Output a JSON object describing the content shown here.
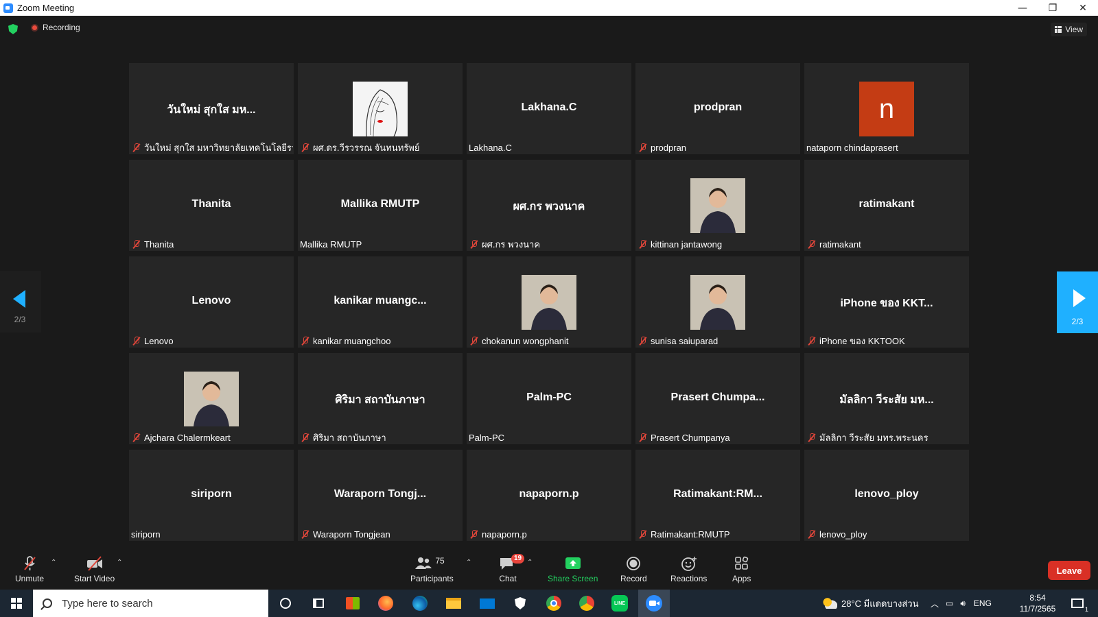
{
  "window": {
    "title": "Zoom Meeting",
    "minimize": "—",
    "restore": "❐",
    "close": "✕"
  },
  "header": {
    "recording": "Recording",
    "view": "View"
  },
  "pager": {
    "left_page": "2/3",
    "right_page": "2/3"
  },
  "participants": [
    {
      "name": "วันใหม่ สุกใส มห...",
      "label": "วันใหม่ สุกใส มหาวิทยาลัยเทคโนโลยีราชม...",
      "muted": true
    },
    {
      "name": "",
      "label": "ผศ.ดร.วีรวรรณ จันทนทรัพย์",
      "muted": true,
      "avatar": "sketch-avatar"
    },
    {
      "name": "Lakhana.C",
      "label": "Lakhana.C",
      "muted": false
    },
    {
      "name": "prodpran",
      "label": "prodpran",
      "muted": true
    },
    {
      "name": "",
      "label": "nataporn chindaprasert",
      "muted": false,
      "avatar_letter": "n"
    },
    {
      "name": "Thanita",
      "label": "Thanita",
      "muted": true
    },
    {
      "name": "Mallika RMUTP",
      "label": "Mallika RMUTP",
      "muted": false
    },
    {
      "name": "ผศ.กร พวงนาค",
      "label": "ผศ.กร พวงนาค",
      "muted": true
    },
    {
      "name": "",
      "label": "kittinan jantawong",
      "muted": true,
      "avatar": "photo-avatar"
    },
    {
      "name": "ratimakant",
      "label": "ratimakant",
      "muted": true
    },
    {
      "name": "Lenovo",
      "label": "Lenovo",
      "muted": true
    },
    {
      "name": "kanikar muangc...",
      "label": "kanikar muangchoo",
      "muted": true
    },
    {
      "name": "",
      "label": "chokanun wongphanit",
      "muted": true,
      "avatar": "photo-avatar"
    },
    {
      "name": "",
      "label": "sunisa saiuparad",
      "muted": true,
      "avatar": "photo-avatar"
    },
    {
      "name": "iPhone ของ KKT...",
      "label": "iPhone ของ KKTOOK",
      "muted": true
    },
    {
      "name": "",
      "label": "Ajchara Chalermkeart",
      "muted": true,
      "avatar": "photo-avatar"
    },
    {
      "name": "ศิริมา สถาบันภาษา",
      "label": "ศิริมา สถาบันภาษา",
      "muted": true
    },
    {
      "name": "Palm-PC",
      "label": "Palm-PC",
      "muted": false
    },
    {
      "name": "Prasert Chumpa...",
      "label": "Prasert Chumpanya",
      "muted": true
    },
    {
      "name": "มัลลิกา วีระสัย มห...",
      "label": "มัลลิกา วีระสัย มทร.พระนคร",
      "muted": true
    },
    {
      "name": "siriporn",
      "label": "siriporn",
      "muted": false
    },
    {
      "name": "Waraporn Tongj...",
      "label": "Waraporn Tongjean",
      "muted": true
    },
    {
      "name": "napaporn.p",
      "label": "napaporn.p",
      "muted": true
    },
    {
      "name": "Ratimakant:RM...",
      "label": "Ratimakant:RMUTP",
      "muted": true
    },
    {
      "name": "lenovo_ploy",
      "label": "lenovo_ploy",
      "muted": true
    }
  ],
  "toolbar": {
    "unmute": "Unmute",
    "start_video": "Start Video",
    "participants": "Participants",
    "participants_count": "75",
    "chat": "Chat",
    "chat_badge": "19",
    "share_screen": "Share Screen",
    "record": "Record",
    "reactions": "Reactions",
    "apps": "Apps",
    "leave": "Leave",
    "caret": "⌃"
  },
  "taskbar": {
    "search_placeholder": "Type here to search",
    "weather": "28°C มีแดดบางส่วน",
    "language": "ENG",
    "time": "8:54",
    "date": "11/7/2565",
    "notifications": "1"
  },
  "colors": {
    "accent": "#1fb0ff",
    "share_green": "#23d160",
    "leave_red": "#d93025",
    "tile_bg": "#262626",
    "muted_red": "#e0463a"
  }
}
